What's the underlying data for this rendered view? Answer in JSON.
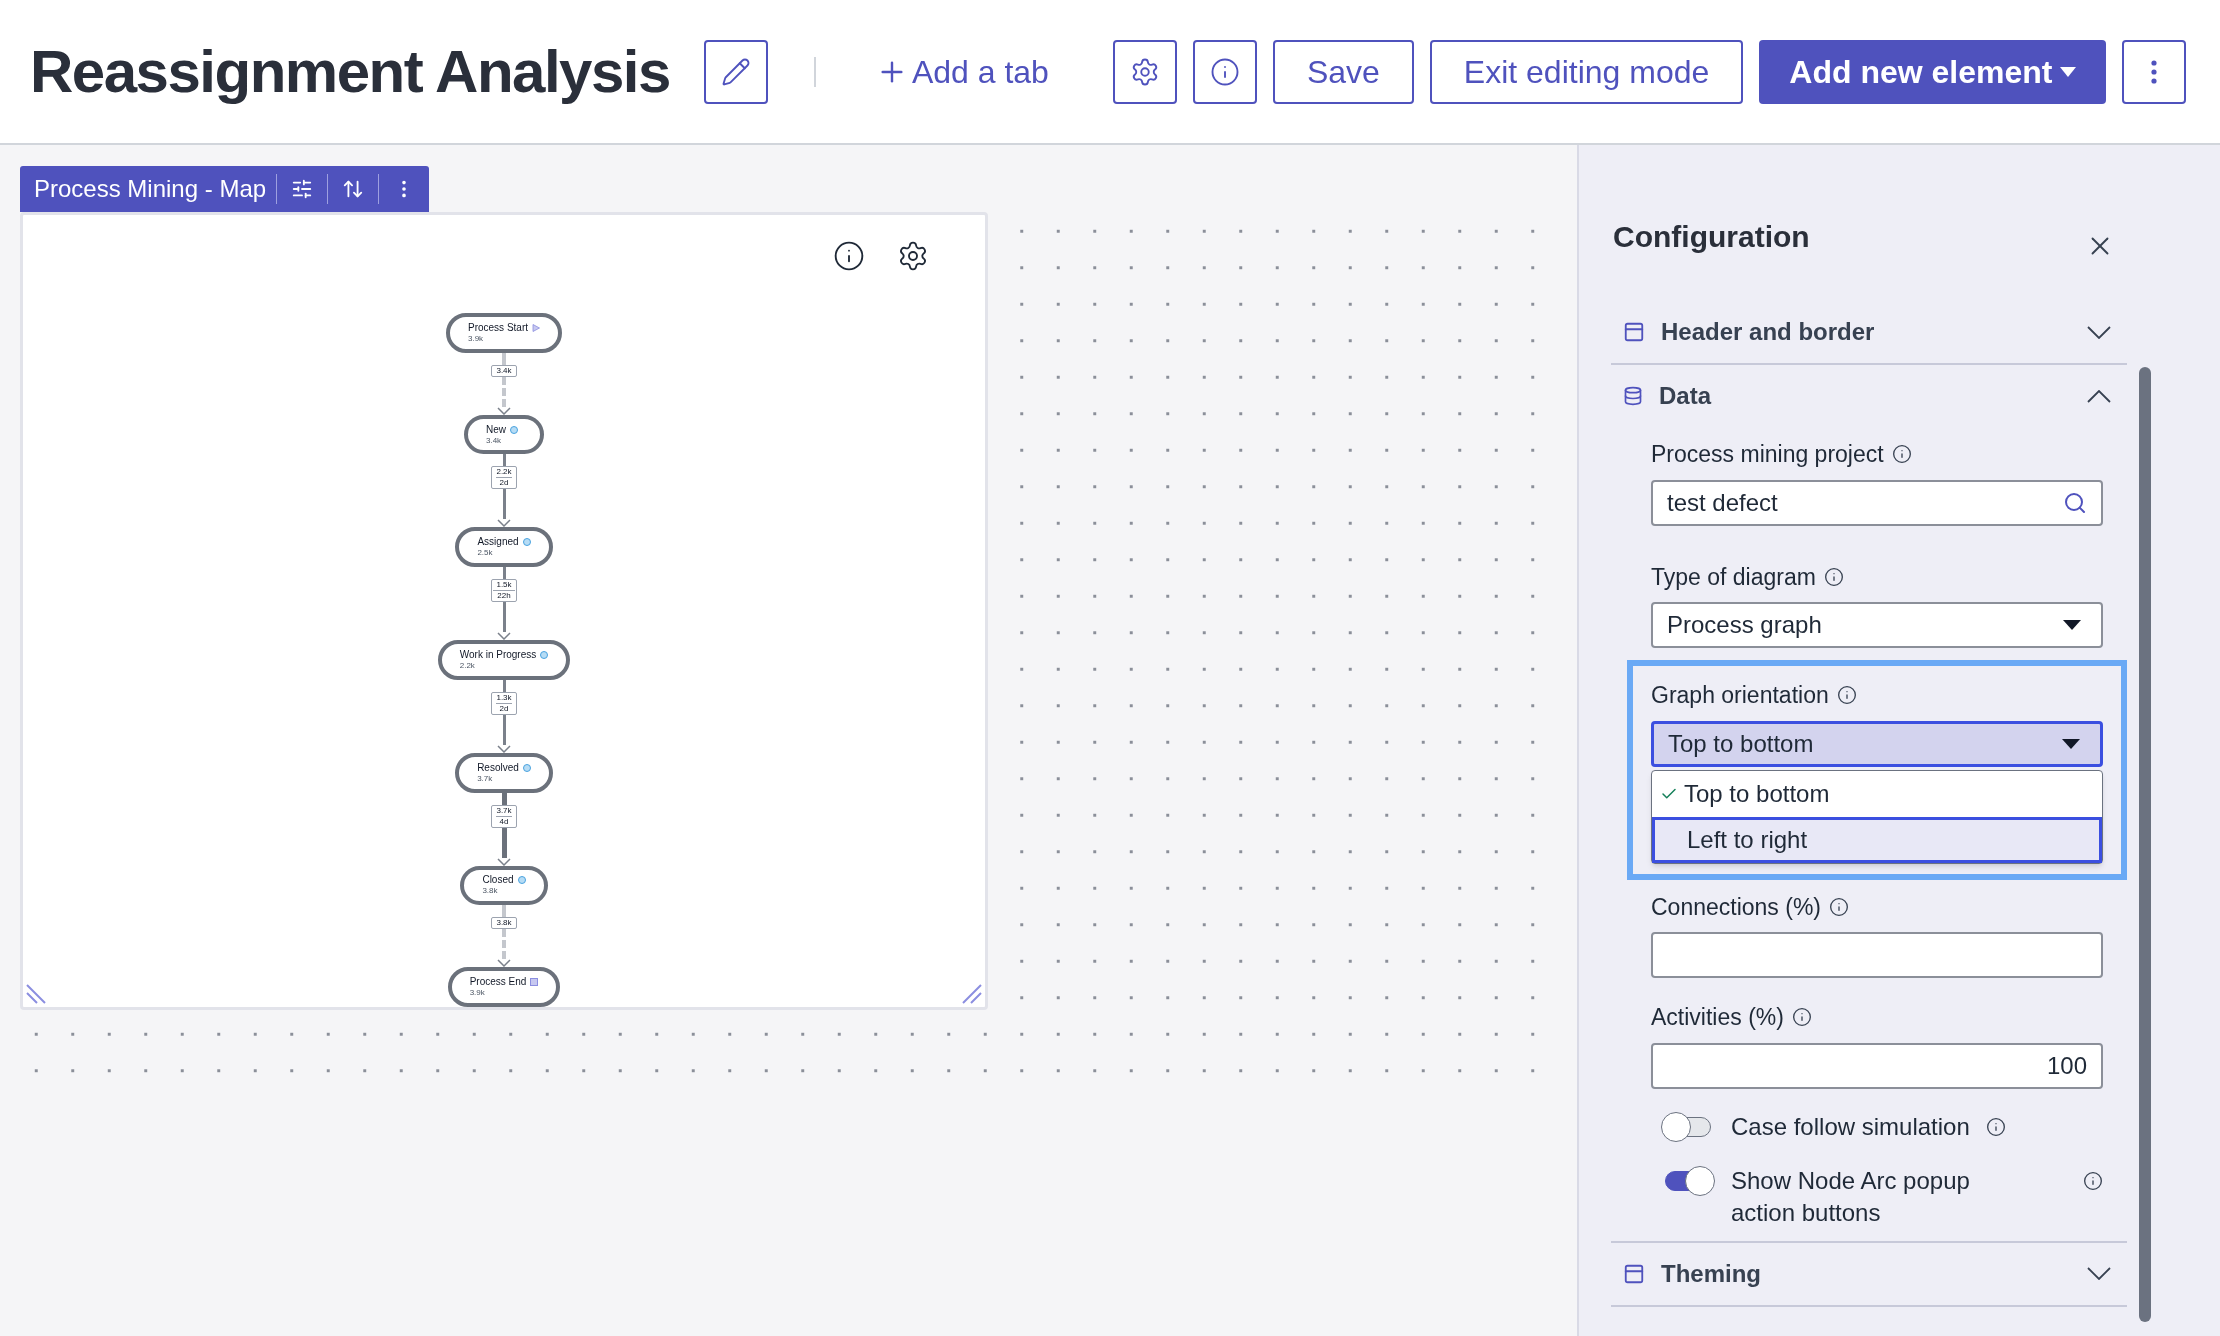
{
  "header": {
    "title": "Reassignment Analysis",
    "add_tab": "Add a tab",
    "buttons": [
      {
        "label": "Save"
      },
      {
        "label": "Exit editing mode"
      }
    ],
    "add_element": "Add new element"
  },
  "widget": {
    "title": "Process Mining - Map",
    "nodes": [
      {
        "label": "Process Start",
        "count": "3.9k",
        "kind": "start"
      },
      {
        "label": "New",
        "count": "3.4k",
        "kind": "activity"
      },
      {
        "label": "Assigned",
        "count": "2.5k",
        "kind": "activity"
      },
      {
        "label": "Work in Progress",
        "count": "2.2k",
        "kind": "activity"
      },
      {
        "label": "Resolved",
        "count": "3.7k",
        "kind": "activity"
      },
      {
        "label": "Closed",
        "count": "3.8k",
        "kind": "activity"
      },
      {
        "label": "Process End",
        "count": "3.9k",
        "kind": "end"
      }
    ],
    "edges": [
      {
        "labels": [
          "3.4k"
        ],
        "kind": "dashed"
      },
      {
        "labels": [
          "2.2k",
          "2d"
        ],
        "kind": "solid"
      },
      {
        "labels": [
          "1.5k",
          "22h"
        ],
        "kind": "solid"
      },
      {
        "labels": [
          "1.3k",
          "2d"
        ],
        "kind": "solid"
      },
      {
        "labels": [
          "3.7k",
          "4d"
        ],
        "kind": "thick"
      },
      {
        "labels": [
          "3.8k"
        ],
        "kind": "dashed"
      }
    ]
  },
  "configuration": {
    "title": "Configuration",
    "sections": [
      {
        "title": "Header and border",
        "expanded": false
      },
      {
        "title": "Data",
        "expanded": true
      },
      {
        "title": "Theming",
        "expanded": false
      }
    ],
    "project": {
      "label": "Process mining project",
      "value": "test defect"
    },
    "diagram_type": {
      "label": "Type of diagram",
      "value": "Process graph"
    },
    "orientation": {
      "label": "Graph orientation",
      "value": "Top to bottom",
      "options": [
        {
          "label": "Top to bottom",
          "selected": true,
          "highlighted": false
        },
        {
          "label": "Left to right",
          "selected": false,
          "highlighted": true
        }
      ]
    },
    "connections": {
      "label": "Connections (%)"
    },
    "activities": {
      "label": "Activities (%)",
      "value": "100"
    },
    "toggles": [
      {
        "label": "Case follow simulation",
        "on": false
      },
      {
        "label": "Show Node Arc popup action buttons",
        "on": true
      }
    ]
  }
}
